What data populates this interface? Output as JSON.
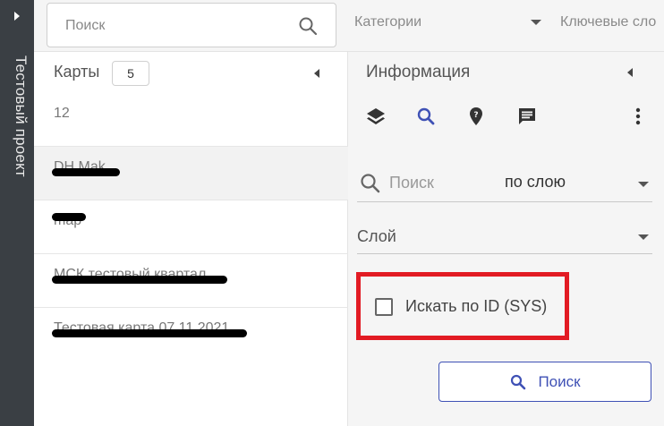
{
  "sidebar": {
    "toggle_icon": "chevron-right-icon",
    "project_title": "Тестовый проект"
  },
  "topbar": {
    "search_placeholder": "Поиск",
    "search_icon": "search-icon",
    "categories_label": "Категории",
    "keywords_label": "Ключевые сло"
  },
  "maps": {
    "title": "Карты",
    "count": "5",
    "items": [
      {
        "label": "12",
        "redacted": true,
        "selected": false
      },
      {
        "label": "DH Mak",
        "redacted": true,
        "selected": true
      },
      {
        "label": "map",
        "redacted": true,
        "selected": false
      },
      {
        "label": "МСК тестовый квартал",
        "redacted": true,
        "selected": false
      },
      {
        "label": "Тестовая карта 07.11.2021",
        "redacted": true,
        "selected": false
      }
    ]
  },
  "info": {
    "title": "Информация",
    "tools": [
      "layers-icon",
      "search-icon",
      "location-pin-icon",
      "comment-icon",
      "more-vert-icon"
    ],
    "search_placeholder": "Поиск",
    "search_mode": "по слою",
    "layer_label": "Слой",
    "checkbox_label": "Искать по ID (SYS)",
    "checkbox_checked": false,
    "search_button_label": "Поиск"
  },
  "colors": {
    "rail": "#3a3f44",
    "accent": "#3f51b5",
    "highlight_box": "#e21b23"
  }
}
